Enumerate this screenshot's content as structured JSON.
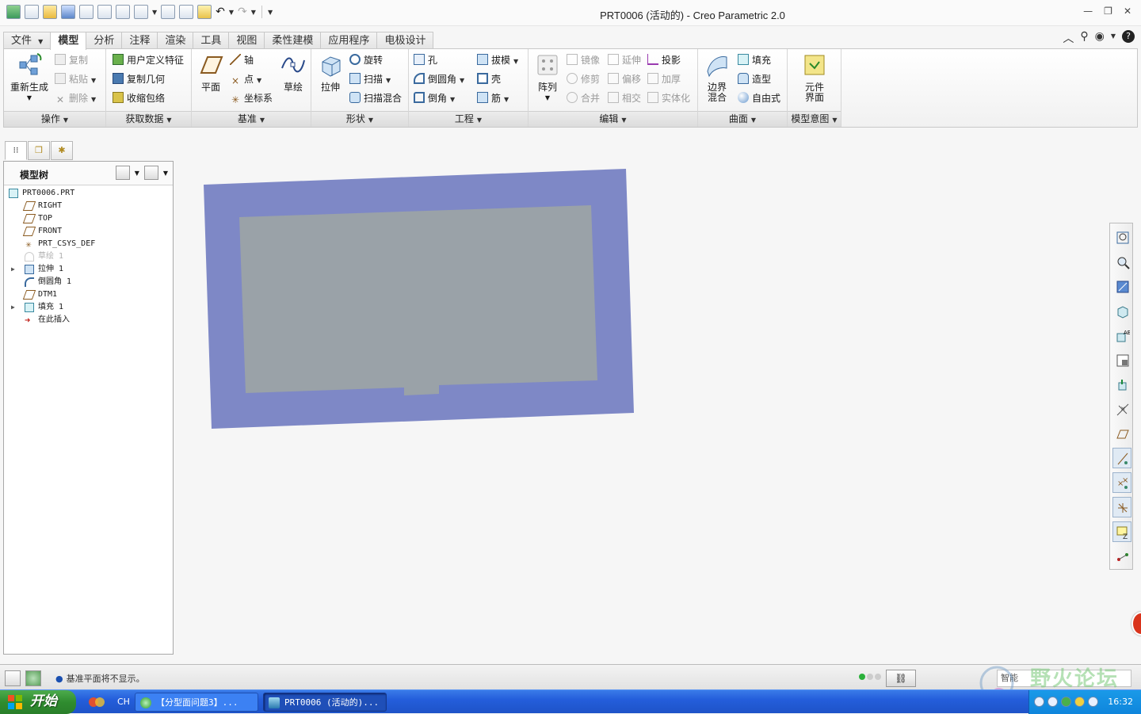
{
  "window": {
    "title": "PRT0006 (活动的) - Creo Parametric 2.0",
    "controls": [
      "minimize",
      "restore",
      "close"
    ]
  },
  "ribbon_tabs": [
    "文件",
    "模型",
    "分析",
    "注释",
    "渲染",
    "工具",
    "视图",
    "柔性建模",
    "应用程序",
    "电极设计"
  ],
  "active_tab": "模型",
  "ribbon": {
    "operations": {
      "label": "操作",
      "regenerate": "重新生成",
      "copy": "复制",
      "paste": "粘贴",
      "delete": "删除"
    },
    "get_data": {
      "label": "获取数据",
      "udf": "用户定义特征",
      "copy_geom": "复制几何",
      "shrinkwrap": "收缩包络"
    },
    "datum": {
      "label": "基准",
      "plane": "平面",
      "axis": "轴",
      "point": "点",
      "csys": "坐标系",
      "sketch": "草绘"
    },
    "shapes": {
      "label": "形状",
      "extrude": "拉伸",
      "revolve": "旋转",
      "sweep": "扫描",
      "swept_blend": "扫描混合"
    },
    "engineering": {
      "label": "工程",
      "hole": "孔",
      "draft": "拔模",
      "round": "倒圆角",
      "shell": "壳",
      "chamfer": "倒角",
      "rib": "筋"
    },
    "editing": {
      "label": "编辑",
      "pattern": "阵列",
      "mirror": "镜像",
      "extend": "延伸",
      "project": "投影",
      "trim": "修剪",
      "offset": "偏移",
      "thicken": "加厚",
      "merge": "合并",
      "intersect": "相交",
      "solidify": "实体化"
    },
    "surfaces": {
      "label": "曲面",
      "boundary_blend": "边界混合",
      "fill": "填充",
      "style": "造型",
      "freestyle": "自由式"
    },
    "model_intent": {
      "label": "模型意图",
      "component_interface": "元件界面"
    }
  },
  "model_tree": {
    "header": "模型树",
    "items": [
      {
        "label": "PRT0006.PRT",
        "icon": "part-icon",
        "level": 0
      },
      {
        "label": "RIGHT",
        "icon": "datum-plane-icon",
        "level": 1
      },
      {
        "label": "TOP",
        "icon": "datum-plane-icon",
        "level": 1
      },
      {
        "label": "FRONT",
        "icon": "datum-plane-icon",
        "level": 1
      },
      {
        "label": "PRT_CSYS_DEF",
        "icon": "csys-icon",
        "level": 1
      },
      {
        "label": "草绘 1",
        "icon": "sketch-icon",
        "level": 1,
        "suppressed": true
      },
      {
        "label": "拉伸 1",
        "icon": "extrude-icon",
        "level": 1,
        "expandable": true
      },
      {
        "label": "倒圆角 1",
        "icon": "round-icon",
        "level": 1
      },
      {
        "label": "DTM1",
        "icon": "datum-plane-icon",
        "level": 1
      },
      {
        "label": "填充 1",
        "icon": "fill-icon",
        "level": 1,
        "expandable": true
      },
      {
        "label": "在此插入",
        "icon": "insert-here-icon",
        "level": 1
      }
    ]
  },
  "status": {
    "message": "基准平面将不显示。",
    "filter": "智能"
  },
  "watermark": "野火论坛",
  "taskbar": {
    "start": "开始",
    "lang": "CH",
    "tasks": [
      "【分型面问题3】...",
      "PRT0006 (活动的)..."
    ],
    "clock": "16:32"
  },
  "colors": {
    "model_outer": "#7e88c6",
    "model_inner": "#9aa2a8",
    "taskbar": "#245edb",
    "start_button": "#2f8c2f"
  }
}
